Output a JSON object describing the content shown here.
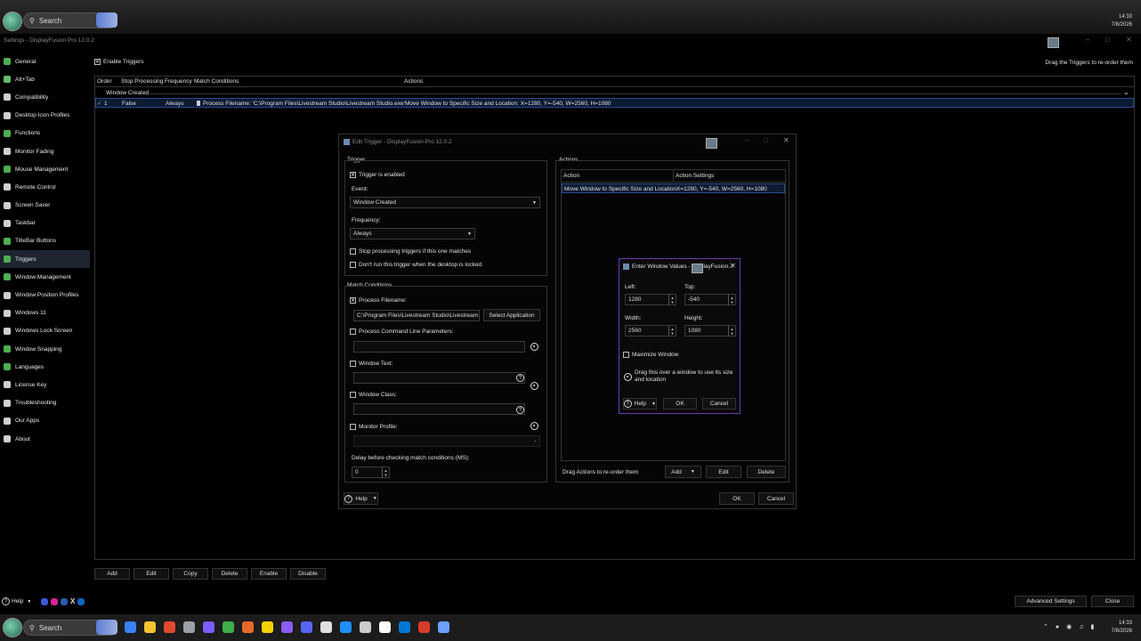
{
  "topbar": {
    "search_label": "Search",
    "time": "14:33",
    "date": "7/8/2026"
  },
  "settings": {
    "title": "Settings - DisplayFusion Pro 12.0.2",
    "sidebar": [
      {
        "label": "General",
        "color": "#4caf50"
      },
      {
        "label": "Alt+Tab",
        "color": "#66bb6a"
      },
      {
        "label": "Compatibility",
        "color": "#cfcfcf"
      },
      {
        "label": "Desktop Icon Profiles",
        "color": "#cfcfcf"
      },
      {
        "label": "Functions",
        "color": "#4caf50"
      },
      {
        "label": "Monitor Fading",
        "color": "#cfcfcf"
      },
      {
        "label": "Mouse Management",
        "color": "#4caf50"
      },
      {
        "label": "Remote Control",
        "color": "#cfcfcf"
      },
      {
        "label": "Screen Saver",
        "color": "#cfcfcf"
      },
      {
        "label": "Taskbar",
        "color": "#cfcfcf"
      },
      {
        "label": "TitleBar Buttons",
        "color": "#4caf50"
      },
      {
        "label": "Triggers",
        "color": "#4caf50"
      },
      {
        "label": "Window Management",
        "color": "#4caf50"
      },
      {
        "label": "Window Position Profiles",
        "color": "#cfcfcf"
      },
      {
        "label": "Windows 11",
        "color": "#cfcfcf"
      },
      {
        "label": "Windows Lock Screen",
        "color": "#cfcfcf"
      },
      {
        "label": "Window Snapping",
        "color": "#4caf50"
      },
      {
        "label": "Languages",
        "color": "#4caf50"
      },
      {
        "label": "License Key",
        "color": "#cfcfcf"
      },
      {
        "label": "Troubleshooting",
        "color": "#cfcfcf"
      },
      {
        "label": "Our Apps",
        "color": "#cfcfcf"
      },
      {
        "label": "About",
        "color": "#cfcfcf"
      }
    ],
    "selected_index": 11,
    "enable_triggers": "Enable Triggers",
    "drag_hint": "Drag the Triggers to re-order them",
    "columns": [
      "Order",
      "Stop Processing",
      "Frequency",
      "Match Conditions",
      "Actions"
    ],
    "group_label": "Window Created",
    "row": {
      "order": "1",
      "stop": "False",
      "frequency": "Always",
      "match": "Process Filename: 'C:\\Program Files\\Livestream Studio\\Livestream Studio.exe'",
      "action": "Move Window to Specific Size and Location: X=1280, Y=-540, W=2560, H=1080"
    },
    "bottom_buttons": [
      "Add",
      "Edit",
      "Copy",
      "Delete",
      "Enable",
      "Disable"
    ],
    "help": "Help",
    "advanced": "Advanced Settings",
    "close": "Close"
  },
  "edit": {
    "title": "Edit Trigger - DisplayFusion Pro 12.0.2",
    "trigger_label": "Trigger",
    "trigger_enabled": "Trigger is enabled",
    "event_label": "Event:",
    "event_value": "Window Created",
    "frequency_label": "Frequency:",
    "frequency_value": "Always",
    "stop_processing": "Stop processing triggers if this one matches",
    "dont_run": "Don't run this trigger when the desktop is locked",
    "match_label": "Match Conditions",
    "process_filename": "Process Filename:",
    "process_value": "C:\\Program Files\\Livestream Studio\\Livestream",
    "select_app": "Select Application",
    "cmdline": "Process Command Line Parameters:",
    "window_text": "Window Text:",
    "window_class": "Window Class:",
    "monitor_profile": "Monitor Profile:",
    "delay_label": "Delay before checking match conditions (MS):",
    "delay_value": "0",
    "actions_label": "Actions",
    "action_cols": [
      "Action",
      "Action Settings"
    ],
    "action_row": {
      "action": "Move Window to Specific Size and Location",
      "settings": "X=1280, Y=-540, W=2560, H=1080"
    },
    "drag_actions": "Drag Actions to re-order them",
    "add": "Add",
    "edit": "Edit",
    "delete": "Delete",
    "help": "Help",
    "ok": "OK",
    "cancel": "Cancel"
  },
  "values": {
    "title": "Enter Window Values - DisplayFusion...",
    "left_label": "Left:",
    "left_value": "1280",
    "top_label": "Top:",
    "top_value": "-540",
    "width_label": "Width:",
    "width_value": "2560",
    "height_label": "Height:",
    "height_value": "1080",
    "maximize": "Maximize Window",
    "drag_hint": "Drag this over a window to use its size and location",
    "help": "Help",
    "ok": "OK",
    "cancel": "Cancel"
  },
  "taskbar": {
    "search_label": "Search",
    "time": "14:33",
    "date": "7/8/2026",
    "apps": [
      "#3b82f6",
      "#f4c430",
      "#e04a2f",
      "#9aa0a6",
      "#7c5cff",
      "#3fae49",
      "#e86a2a",
      "#f5d300",
      "#8a5cf6",
      "#5865f2",
      "#e0e0e0",
      "#1e90ff",
      "#cccccc",
      "#ffffff",
      "#0078d4",
      "#d83b2b",
      "#6aa0ff"
    ]
  }
}
